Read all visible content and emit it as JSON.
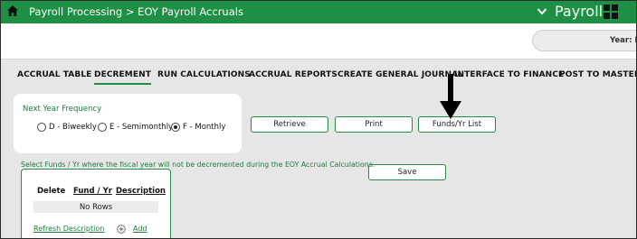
{
  "topbar": {
    "breadcrumb": "Payroll Processing > EOY Payroll Accruals",
    "app_name": "Payroll",
    "icons": {
      "home": "home-icon",
      "chevron": "chevron-down-icon",
      "apps": "apps-grid-icon"
    },
    "accent": "#1e8f45"
  },
  "header": {
    "year_label": "Year: N"
  },
  "tabs": [
    {
      "label": "ACCRUAL TABLE",
      "active": false
    },
    {
      "label": "DECREMENT",
      "active": true
    },
    {
      "label": "RUN CALCULATIONS",
      "active": false
    },
    {
      "label": "ACCRUAL REPORTS",
      "active": false
    },
    {
      "label": "CREATE GENERAL JOURNAL",
      "active": false
    },
    {
      "label": "INTERFACE TO FINANCE",
      "active": false
    },
    {
      "label": "POST TO MASTER",
      "active": false
    }
  ],
  "frequency": {
    "title": "Next Year Frequency",
    "options": [
      {
        "label": "D - Biweekly",
        "checked": false
      },
      {
        "label": "E - Semimonthly",
        "checked": false
      },
      {
        "label": "F - Monthly",
        "checked": true
      }
    ]
  },
  "buttons": {
    "retrieve": "Retrieve",
    "print": "Print",
    "funds_list": "Funds/Yr List",
    "save": "Save"
  },
  "instruction": "Select Funds / Yr where the fiscal year will not be decremented during the EOY Accrual Calculations.",
  "table": {
    "columns": [
      "Delete",
      "Fund / Yr",
      "Description"
    ],
    "empty_text": "No Rows",
    "refresh_link": "Refresh Description",
    "add_link": "Add"
  }
}
